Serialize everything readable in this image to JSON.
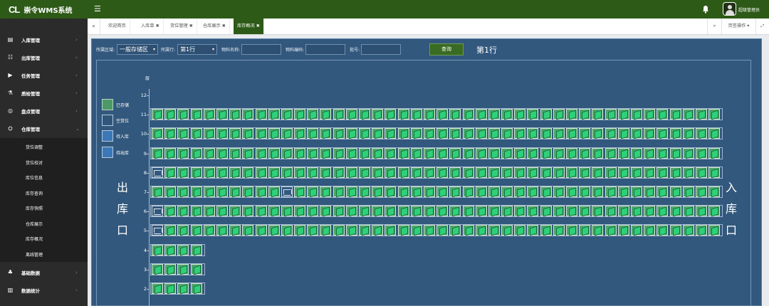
{
  "app": {
    "logo_mark": "CL",
    "title": "崇令WMS系统",
    "user_name": "超级管理员"
  },
  "sidebar": {
    "items": [
      {
        "label": "入库管理"
      },
      {
        "label": "出库管理"
      },
      {
        "label": "任务管理"
      },
      {
        "label": "质检管理"
      },
      {
        "label": "盘点管理"
      },
      {
        "label": "仓库管理",
        "expanded": true
      },
      {
        "label": "基础数据"
      },
      {
        "label": "数据统计"
      }
    ],
    "submenu": [
      "货位调整",
      "货位校对",
      "库位信息",
      "库存查询",
      "库存快照",
      "仓库展示",
      "库存概况",
      "离线管理"
    ]
  },
  "tabs": [
    {
      "label": "欢迎首页",
      "closable": false
    },
    {
      "label": "入库单",
      "closable": true
    },
    {
      "label": "货位管理",
      "closable": true
    },
    {
      "label": "仓库展示",
      "closable": true
    },
    {
      "label": "库存概况",
      "closable": true,
      "active": true
    }
  ],
  "tab_controls": {
    "page_ops": "页签操作"
  },
  "filter": {
    "area_label": "所属区域:",
    "area_value": "一般存储区",
    "row_label": "所属行:",
    "row_value": "第1行",
    "material_name_label": "物料名称:",
    "material_code_label": "物料编码:",
    "batch_label": "批号:",
    "query_button": "查询",
    "row_title": "第1行"
  },
  "legend": [
    {
      "key": "stored",
      "label": "已存储"
    },
    {
      "key": "empty",
      "label": "空货位"
    },
    {
      "key": "in",
      "label": "待入库"
    },
    {
      "key": "out",
      "label": "待出库"
    }
  ],
  "side_labels": {
    "left": [
      "出",
      "库",
      "口"
    ],
    "right": [
      "入",
      "库",
      "口"
    ]
  },
  "axis_title": "层",
  "levels": [
    {
      "level": "12",
      "slots": []
    },
    {
      "level": "11",
      "slots": "SSSSSSSSSSSSSSSSSSSSSSSSSSSSSSSSSSSSSSSSSSSSSSSSSSSSSSSSSSSSSSSSS"
    },
    {
      "level": "10",
      "slots": "SSSSSSSSSSSSSSSSSSSSSSSSSSSSSSSSSSSSSSSSSSSSSSSSSSSSSSSSSSSSSSSSS"
    },
    {
      "level": "9",
      "slots": "SSSSSSSSSSSSSSSSSSSSSSSSSSSSSSSSSSSSSSSSSSSSSSSSSSSSSSSSSSSSSSSSS"
    },
    {
      "level": "8",
      "slots": "ESSSSSSSSSSSSSSSSSSSSSSSSSSSSSSSSSSSSSSSSSSSSSSSSSSSSSSSSSSSSSSSSS"
    },
    {
      "level": "7",
      "slots": "SSSSSSSSSSESSSSSSSSSSSSSSSSSSSSSSSSSSSSSSSSSSSSSSSSSSSSSSSSSSSSSSS"
    },
    {
      "level": "6",
      "slots": "ESSSSSSSSSSSSSSSSSSSSSSSSSSSSSSSSSSSSSSSSSSSSSSSSSSSSSSSSSSSSSSSSS"
    },
    {
      "level": "5",
      "slots": "ESSSSSSSSSSSSSSSSSSSSSSSSSSSSSSSSSSSSSSSSSSSSSSSSSSSSSSSSSSSSSSSSS"
    },
    {
      "level": "4",
      "slots": "SSSS"
    },
    {
      "level": "3",
      "slots": "SSSS"
    },
    {
      "level": "2",
      "slots": "SSSS"
    }
  ]
}
